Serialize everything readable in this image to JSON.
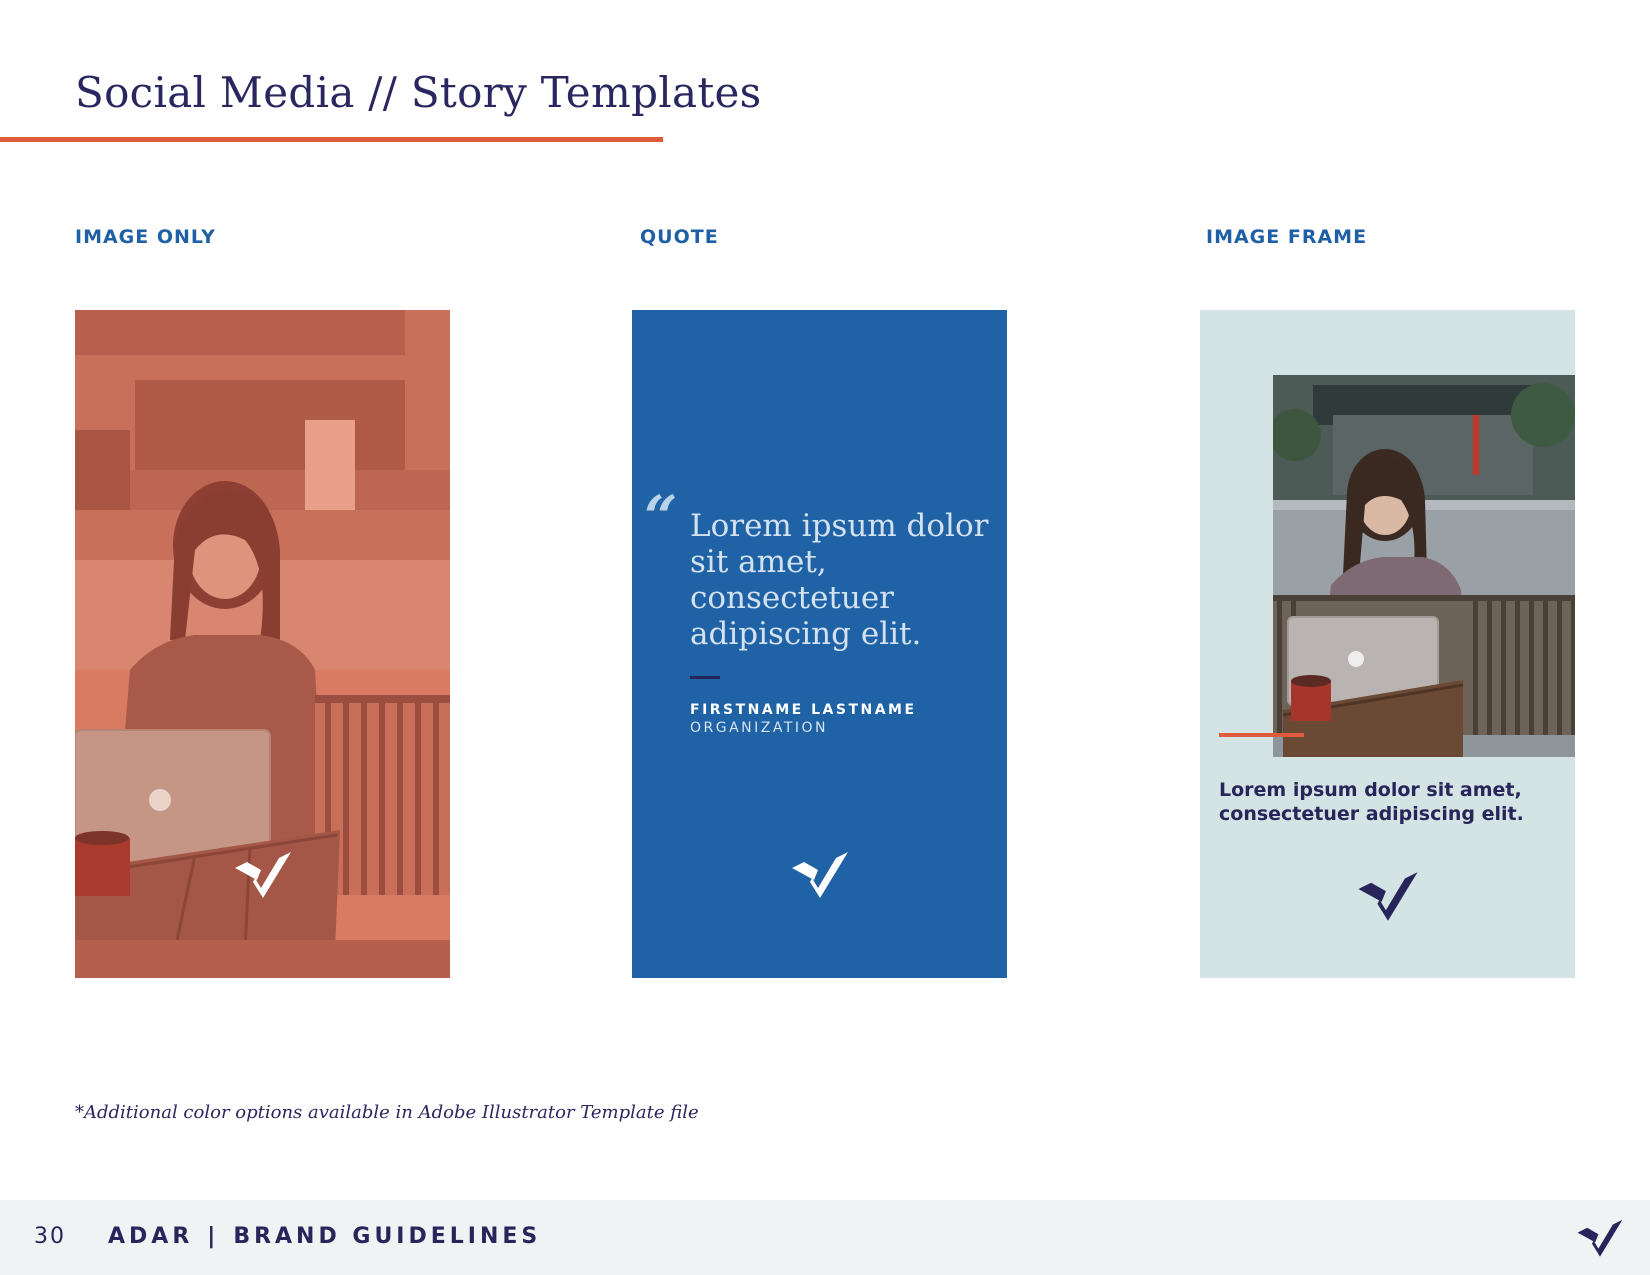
{
  "header": {
    "title": "Social Media // Story Templates"
  },
  "columns": [
    {
      "label": "IMAGE ONLY"
    },
    {
      "label": "QUOTE"
    },
    {
      "label": "IMAGE FRAME"
    }
  ],
  "quote_card": {
    "quote_mark": "“",
    "text": "Lorem ipsum dolor sit amet, consectetuer adipiscing elit.",
    "name": "FIRSTNAME LASTNAME",
    "organization": "ORGANIZATION"
  },
  "frame_card": {
    "text": "Lorem ipsum dolor sit amet, consectetuer adipiscing elit."
  },
  "footnote": "*Additional color options available in Adobe Illustrator Template file",
  "footer": {
    "page_number": "30",
    "brand": "ADAR",
    "separator": "|",
    "section": "BRAND GUIDELINES"
  },
  "colors": {
    "navy": "#27255a",
    "accent_orange": "#e05a3c",
    "label_blue": "#1f5fa5",
    "quote_card_bg": "#1f62a5",
    "frame_card_bg": "#d4e3e3",
    "image_tint": "#d97a63",
    "footer_bg": "#f1f2f4"
  },
  "icons": [
    "checkmark-logo-icon",
    "quote-mark-icon"
  ]
}
